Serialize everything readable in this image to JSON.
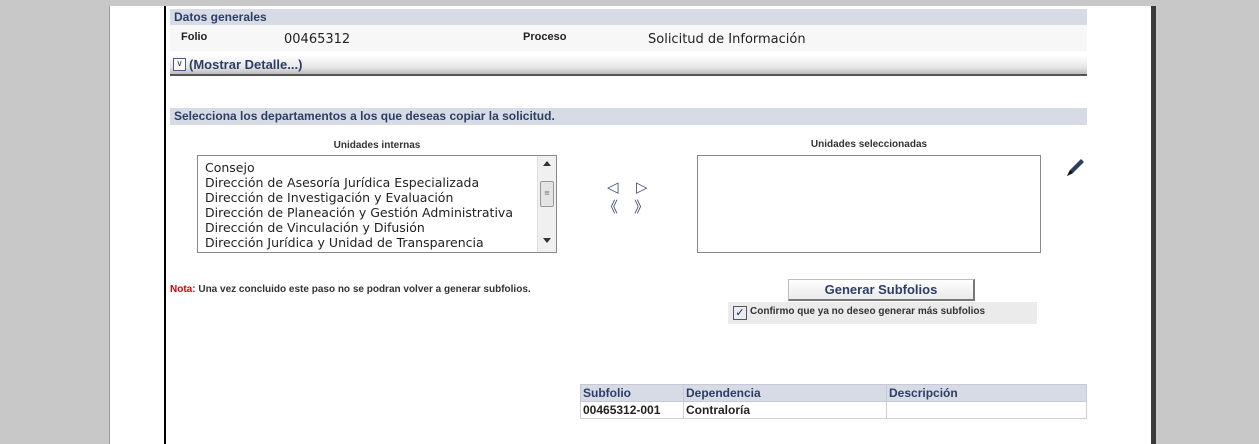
{
  "general": {
    "section_title": "Datos generales",
    "folio_label": "Folio",
    "folio_value": "00465312",
    "proceso_label": "Proceso",
    "proceso_value": "Solicitud de Información",
    "detail_icon": "double-chevron-down-icon",
    "detail_link": "(Mostrar Detalle...)"
  },
  "select_section": {
    "title": "Selecciona los departamentos a los que deseas copiar la solicitud.",
    "internal_title": "Unidades internas",
    "selected_title": "Unidades seleccionadas",
    "internal_units": [
      "Consejo",
      "Dirección de Asesoría Jurídica Especializada",
      "Dirección de Investigación y Evaluación",
      "Dirección de Planeación y Gestión Administrativa",
      "Dirección de Vinculación y Difusión",
      "Dirección Jurídica y Unidad de Transparencia"
    ],
    "selected_units": [],
    "arrows": {
      "move_left": "◁",
      "move_right": "▷",
      "move_all_left": "《",
      "move_all_right": "》"
    },
    "edit_icon": "pencil-icon"
  },
  "note": {
    "label": "Nota:",
    "text": "Una vez concluido este paso no se podran volver a generar subfolios."
  },
  "actions": {
    "generate_button": "Generar Subfolios",
    "confirm_checked": true,
    "confirm_label": "Confirmo que ya no deseo generar más subfolios"
  },
  "subfolio_table": {
    "headers": [
      "Subfolio",
      "Dependencia",
      "Descripción"
    ],
    "rows": [
      [
        "00465312-001",
        "Contraloría",
        ""
      ]
    ]
  }
}
